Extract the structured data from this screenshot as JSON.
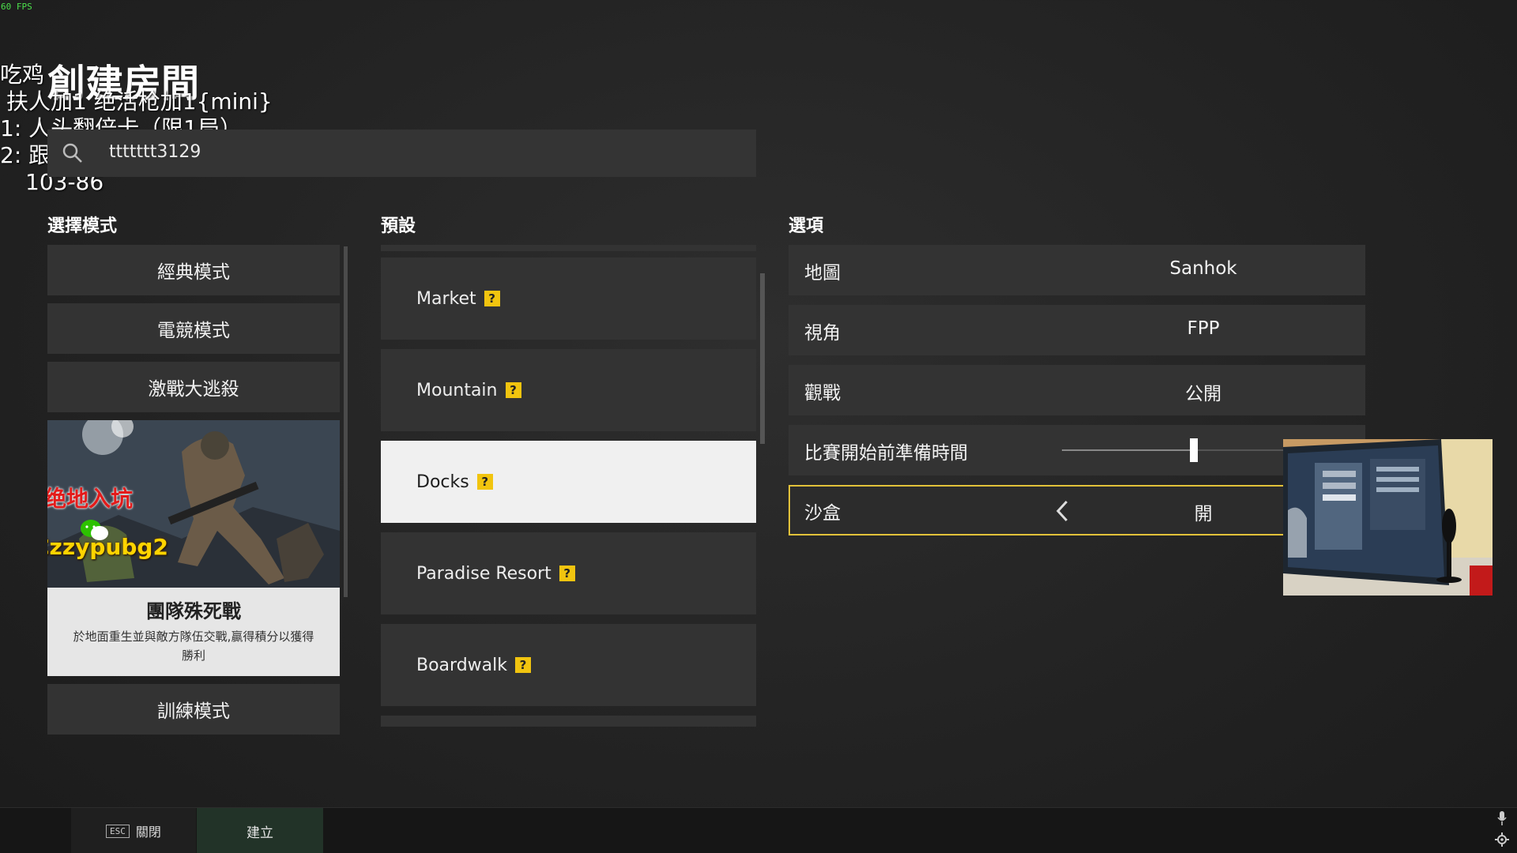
{
  "fps_label": "60 FPS",
  "stream_overlay": {
    "line1": "吃鸡",
    "line2": "扶人加1 绝活枪加1{mini}",
    "line3": "1:  人头翻倍卡（限1局）",
    "line4": "2:  跟对方大头互换（限1局）",
    "line5": "103-86"
  },
  "page_title": "創建房間",
  "room_name_value": "ttttttt3129",
  "sections": {
    "modes": "選擇模式",
    "presets": "預設",
    "options": "選項"
  },
  "modes": {
    "classic": "經典模式",
    "esports": "電競模式",
    "war": "激戰大逃殺",
    "selected_card": {
      "name": "團隊殊死戰",
      "description": "於地面重生並與敵方隊伍交戰,贏得積分以獲得勝利"
    },
    "training": "訓練模式"
  },
  "watermark": {
    "red_text": "绝地入坑",
    "yellow_text": "Czzypubg2"
  },
  "presets": [
    {
      "label": "Market",
      "help": "?"
    },
    {
      "label": "Mountain",
      "help": "?"
    },
    {
      "label": "Docks",
      "help": "?"
    },
    {
      "label": "Paradise Resort",
      "help": "?"
    },
    {
      "label": "Boardwalk",
      "help": "?"
    }
  ],
  "selected_preset_index": 2,
  "options": {
    "map": {
      "label": "地圖",
      "value": "Sanhok"
    },
    "perspective": {
      "label": "視角",
      "value": "FPP"
    },
    "spectate": {
      "label": "觀戰",
      "value": "公開"
    },
    "prep_time": {
      "label": "比賽開始前準備時間",
      "slider_fraction": 0.44
    },
    "sandbox": {
      "label": "沙盒",
      "value": "開"
    }
  },
  "bottom_bar": {
    "esc_key": "ESC",
    "close_label": "關閉",
    "create_label": "建立"
  },
  "colors": {
    "accent_yellow": "#e2c23a",
    "help_icon": "#f1c40f",
    "watermark_red": "#e31b1b",
    "watermark_yellow": "#ffd400"
  }
}
